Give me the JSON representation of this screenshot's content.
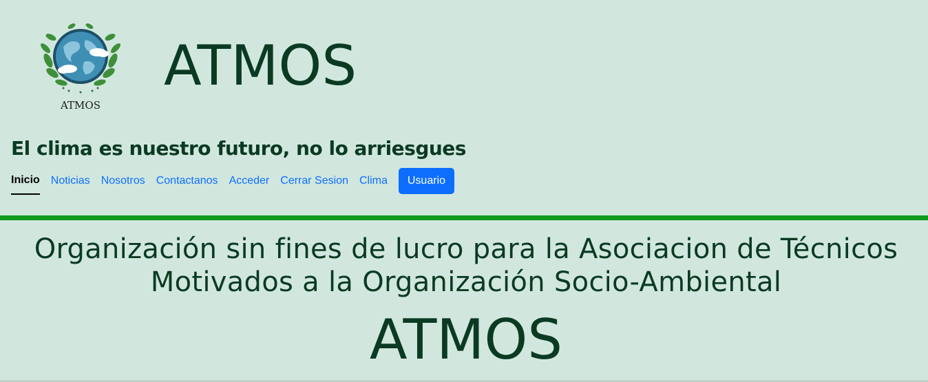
{
  "header": {
    "logo_caption": "ATMOS",
    "site_title": "ATMOS",
    "tagline": "El clima es nuestro futuro, no lo arriesgues"
  },
  "nav": {
    "items": [
      {
        "label": "Inicio",
        "active": true
      },
      {
        "label": "Noticias"
      },
      {
        "label": "Nosotros"
      },
      {
        "label": "Contactanos"
      },
      {
        "label": "Acceder"
      },
      {
        "label": "Cerrar Sesion"
      },
      {
        "label": "Clima"
      }
    ],
    "user_button": "Usuario"
  },
  "main": {
    "mission_line1": "Organización sin fines de lucro para la Asociacion de Técnicos",
    "mission_line2": "Motivados a la Organización Socio-Ambiental",
    "big_title": "ATMOS"
  },
  "colors": {
    "background": "#d1e7de",
    "text": "#0b3a22",
    "link": "#0d6efd",
    "divider": "#0f9a1e"
  }
}
